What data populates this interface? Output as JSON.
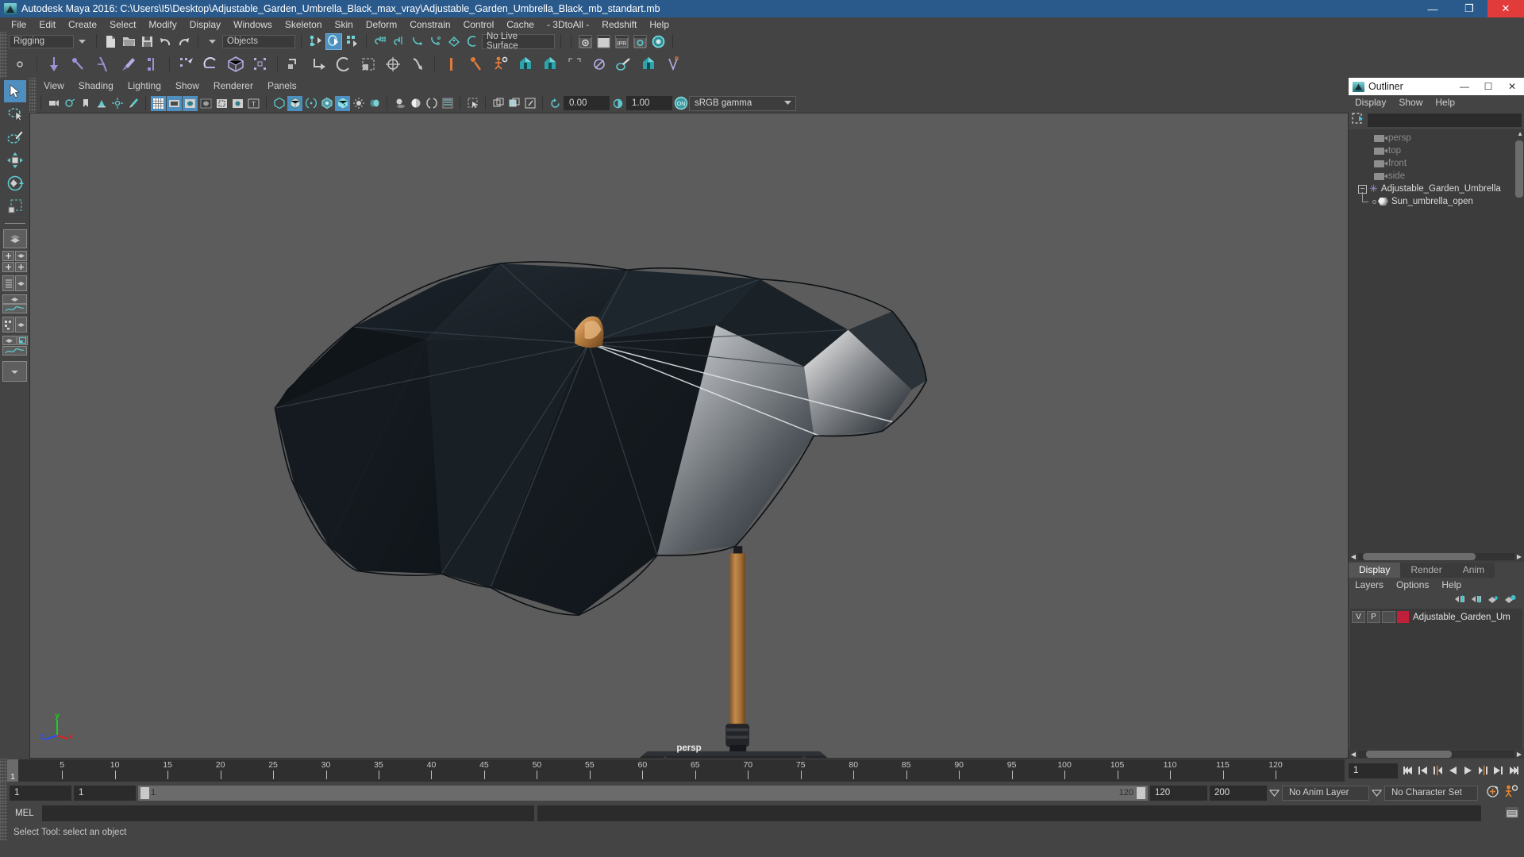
{
  "titlebar": {
    "title": "Autodesk Maya 2016: C:\\Users\\I5\\Desktop\\Adjustable_Garden_Umbrella_Black_max_vray\\Adjustable_Garden_Umbrella_Black_mb_standart.mb",
    "minimize": "—",
    "maximize": "❐",
    "close": "✕"
  },
  "menubar": {
    "items": [
      "File",
      "Edit",
      "Create",
      "Select",
      "Modify",
      "Display",
      "Windows",
      "Skeleton",
      "Skin",
      "Deform",
      "Constrain",
      "Control",
      "Cache",
      "- 3DtoAll -",
      "Redshift",
      "Help"
    ]
  },
  "statusline": {
    "menuset": "Rigging",
    "selection_mask": "Objects",
    "live_surface": "No Live Surface"
  },
  "viewport_menu": {
    "items": [
      "View",
      "Shading",
      "Lighting",
      "Show",
      "Renderer",
      "Panels"
    ]
  },
  "viewport_toolbar": {
    "exposure": "0.00",
    "gamma": "1.00",
    "color_management": "sRGB gamma"
  },
  "viewport": {
    "camera_label": "persp",
    "axis_x": "x",
    "axis_y": "y",
    "axis_z": "z",
    "background_color": "#5c5c5c"
  },
  "outliner": {
    "window_title": "Outliner",
    "minimize": "—",
    "maximize": "☐",
    "close": "✕",
    "menu": [
      "Display",
      "Show",
      "Help"
    ],
    "search_value": "",
    "items": [
      {
        "label": "persp",
        "icon": "camera-icon",
        "depth": 1,
        "dim": true
      },
      {
        "label": "top",
        "icon": "camera-icon",
        "depth": 1,
        "dim": true
      },
      {
        "label": "front",
        "icon": "camera-icon",
        "depth": 1,
        "dim": true
      },
      {
        "label": "side",
        "icon": "camera-icon",
        "depth": 1,
        "dim": true
      },
      {
        "label": "Adjustable_Garden_Umbrella",
        "icon": "group-icon",
        "depth": 0,
        "dim": false
      },
      {
        "label": "Sun_umbrella_open",
        "icon": "mesh-icon",
        "depth": 1,
        "dim": false
      }
    ]
  },
  "layer_editor": {
    "tabs": [
      "Display",
      "Render",
      "Anim"
    ],
    "active_tab": "Display",
    "menu": [
      "Layers",
      "Options",
      "Help"
    ],
    "layers": [
      {
        "visibility": "V",
        "playback": "P",
        "state": "",
        "color": "#c0203a",
        "name": "Adjustable_Garden_Um"
      }
    ]
  },
  "timeline": {
    "current_frame": "1",
    "ticks": [
      5,
      10,
      15,
      20,
      25,
      30,
      35,
      40,
      45,
      50,
      55,
      60,
      65,
      70,
      75,
      80,
      85,
      90,
      95,
      100,
      105,
      110,
      115,
      120
    ],
    "start": 1,
    "end": 120,
    "frame_field": "1"
  },
  "range": {
    "anim_start": "1",
    "playback_start": "1",
    "bar_left": "1",
    "bar_right": "120",
    "playback_end": "120",
    "anim_end": "200",
    "anim_layer": "No Anim Layer",
    "character_set": "No Character Set"
  },
  "command_line": {
    "language": "MEL",
    "value": ""
  },
  "statusbar": {
    "help_text": "Select Tool: select an object"
  }
}
